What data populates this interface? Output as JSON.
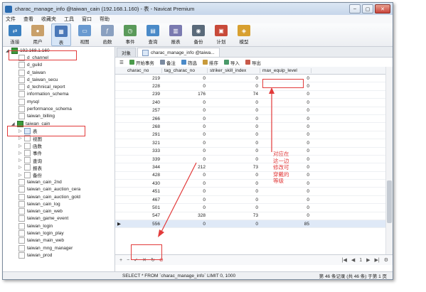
{
  "window": {
    "title": "charac_manage_info @taiwan_cain (192.168.1.160) - 表 - Navicat Premium"
  },
  "menu": [
    "文件",
    "查看",
    "收藏夹",
    "工具",
    "窗口",
    "帮助"
  ],
  "toolbar": [
    {
      "label": "连接",
      "icon": "connect-icon",
      "color": "#3a7fc0"
    },
    {
      "label": "用户",
      "icon": "user-icon",
      "color": "#c9a06a"
    },
    {
      "label": "表",
      "icon": "table-icon",
      "color": "#4a78b8"
    },
    {
      "label": "视图",
      "icon": "view-icon",
      "color": "#6a9ad0"
    },
    {
      "label": "函数",
      "icon": "function-icon",
      "color": "#8aa0c0"
    },
    {
      "label": "事件",
      "icon": "event-icon",
      "color": "#5a9a5a"
    },
    {
      "label": "查询",
      "icon": "query-icon",
      "color": "#4a8ac8"
    },
    {
      "label": "报表",
      "icon": "report-icon",
      "color": "#7a7ab0"
    },
    {
      "label": "备份",
      "icon": "backup-icon",
      "color": "#5a6a7a"
    },
    {
      "label": "计划",
      "icon": "schedule-icon",
      "color": "#c84a3a"
    },
    {
      "label": "模型",
      "icon": "model-icon",
      "color": "#d8a030"
    }
  ],
  "sidebar": {
    "items": [
      {
        "label": "192.168.1.160",
        "level": 0,
        "icon": "connection-icon"
      },
      {
        "label": "d_channel",
        "level": 2,
        "icon": "database-icon"
      },
      {
        "label": "d_guild",
        "level": 2,
        "icon": "database-icon"
      },
      {
        "label": "d_taiwan",
        "level": 2,
        "icon": "database-icon"
      },
      {
        "label": "d_taiwan_secu",
        "level": 2,
        "icon": "database-icon"
      },
      {
        "label": "d_technical_report",
        "level": 2,
        "icon": "database-icon"
      },
      {
        "label": "information_schema",
        "level": 2,
        "icon": "database-icon"
      },
      {
        "label": "mysql",
        "level": 2,
        "icon": "database-icon"
      },
      {
        "label": "performance_schema",
        "level": 2,
        "icon": "database-icon"
      },
      {
        "label": "taiwan_billing",
        "level": 2,
        "icon": "database-icon"
      },
      {
        "label": "taiwan_cain",
        "level": 1,
        "icon": "database-open-icon"
      },
      {
        "label": "表",
        "level": 3,
        "icon": "table-icon"
      },
      {
        "label": "视图",
        "level": 3,
        "icon": "view-icon"
      },
      {
        "label": "函数",
        "level": 3,
        "icon": "function-icon"
      },
      {
        "label": "事件",
        "level": 3,
        "icon": "event-icon"
      },
      {
        "label": "查询",
        "level": 3,
        "icon": "query-icon"
      },
      {
        "label": "报表",
        "level": 3,
        "icon": "report-icon"
      },
      {
        "label": "备份",
        "level": 3,
        "icon": "backup-icon"
      },
      {
        "label": "taiwan_cain_2nd",
        "level": 2,
        "icon": "database-icon"
      },
      {
        "label": "taiwan_cain_auction_cera",
        "level": 2,
        "icon": "database-icon"
      },
      {
        "label": "taiwan_cain_auction_gold",
        "level": 2,
        "icon": "database-icon"
      },
      {
        "label": "taiwan_cain_log",
        "level": 2,
        "icon": "database-icon"
      },
      {
        "label": "taiwan_cain_web",
        "level": 2,
        "icon": "database-icon"
      },
      {
        "label": "taiwan_game_event",
        "level": 2,
        "icon": "database-icon"
      },
      {
        "label": "taiwan_login",
        "level": 2,
        "icon": "database-icon"
      },
      {
        "label": "taiwan_login_play",
        "level": 2,
        "icon": "database-icon"
      },
      {
        "label": "taiwan_main_web",
        "level": 2,
        "icon": "database-icon"
      },
      {
        "label": "taiwan_mng_manager",
        "level": 2,
        "icon": "database-icon"
      },
      {
        "label": "taiwan_prod",
        "level": 2,
        "icon": "database-icon"
      }
    ]
  },
  "tabs": [
    {
      "label": "对象"
    },
    {
      "label": "charac_manage_info @taiwa..."
    }
  ],
  "subtoolbar": [
    "开始事务",
    "备注",
    "筛选",
    "排序",
    "导入",
    "导出"
  ],
  "grid": {
    "columns": [
      "charac_no",
      "tag_charac_no",
      "striker_skill_index",
      "max_equip_level"
    ],
    "rows": [
      [
        "219",
        "0",
        "0",
        "0"
      ],
      [
        "228",
        "0",
        "0",
        "0"
      ],
      [
        "239",
        "176",
        "74",
        "0"
      ],
      [
        "240",
        "0",
        "0",
        "0"
      ],
      [
        "257",
        "0",
        "0",
        "0"
      ],
      [
        "266",
        "0",
        "0",
        "0"
      ],
      [
        "268",
        "0",
        "0",
        "0"
      ],
      [
        "291",
        "0",
        "0",
        "0"
      ],
      [
        "321",
        "0",
        "0",
        "0"
      ],
      [
        "333",
        "0",
        "0",
        "0"
      ],
      [
        "339",
        "0",
        "0",
        "0"
      ],
      [
        "344",
        "212",
        "73",
        "0"
      ],
      [
        "428",
        "0",
        "0",
        "0"
      ],
      [
        "430",
        "0",
        "0",
        "0"
      ],
      [
        "451",
        "0",
        "0",
        "0"
      ],
      [
        "467",
        "0",
        "0",
        "0"
      ],
      [
        "501",
        "0",
        "0",
        "0"
      ],
      [
        "547",
        "328",
        "73",
        "0"
      ],
      [
        "556",
        "0",
        "0",
        "85"
      ]
    ],
    "selected_row": 18
  },
  "pager": {
    "page": "1"
  },
  "status": {
    "sql": "SELECT * FROM `charac_manage_info` LIMIT 0, 1000",
    "records": "第 46 条记录 (共 46 条) 于第 1 页"
  },
  "annotation": {
    "text": "对应在这一边修改可穿戴的等级",
    "color": "#e23a3a"
  }
}
